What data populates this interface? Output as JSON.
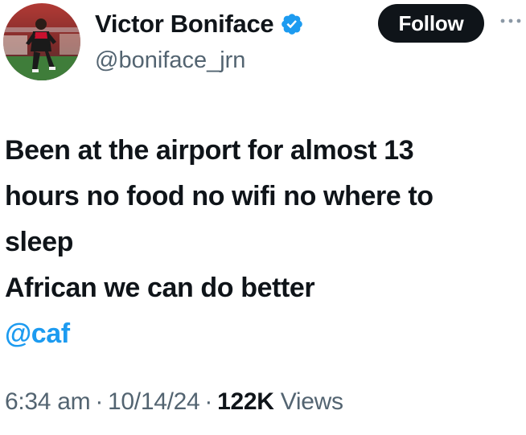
{
  "author": {
    "display_name": "Victor Boniface",
    "handle": "@boniface_jrn",
    "verified_icon": "verified-badge-icon",
    "avatar_icon": "avatar"
  },
  "actions": {
    "follow_label": "Follow",
    "more_icon": "more-options-icon"
  },
  "tweet": {
    "lines": [
      "Been at the airport for almost 13",
      "hours no food no wifi no where to",
      "sleep",
      "African we can do better"
    ],
    "mention": "@caf"
  },
  "meta": {
    "time": "6:34 am",
    "separator": "·",
    "date": "10/14/24",
    "views_count": "122K",
    "views_label": "Views"
  },
  "colors": {
    "text": "#0f1419",
    "secondary": "#536471",
    "link": "#1d9bf0",
    "verified": "#1d9bf0",
    "button_bg": "#0f1419"
  }
}
